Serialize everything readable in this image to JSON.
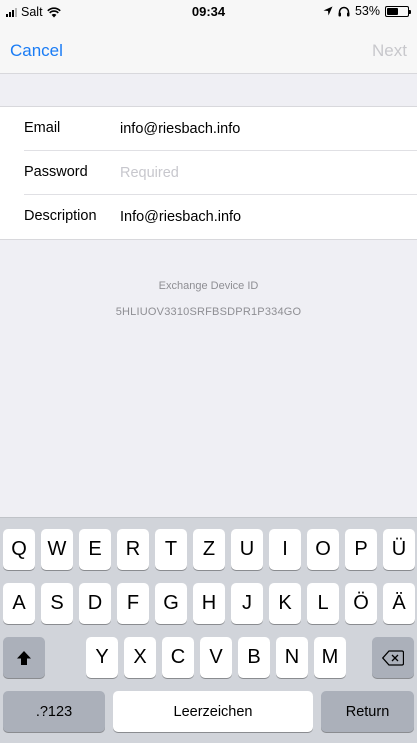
{
  "status_bar": {
    "carrier": "Salt",
    "time": "09:34",
    "battery": "53%",
    "battery_level": 0.53,
    "icons": [
      "signal-icon",
      "wifi-icon",
      "location-icon",
      "headphones-icon",
      "battery-icon"
    ]
  },
  "nav": {
    "cancel_label": "Cancel",
    "next_label": "Next"
  },
  "form": {
    "email_label": "Email",
    "email_value": "info@riesbach.info",
    "password_label": "Password",
    "password_placeholder": "Required",
    "description_label": "Description",
    "description_value": "Info@riesbach.info"
  },
  "device": {
    "title": "Exchange Device ID",
    "id": "5HLIUOV3310SRFBSDPR1P334GO"
  },
  "keyboard": {
    "row1": [
      "Q",
      "W",
      "E",
      "R",
      "T",
      "Z",
      "U",
      "I",
      "O",
      "P",
      "Ü"
    ],
    "row2": [
      "A",
      "S",
      "D",
      "F",
      "G",
      "H",
      "J",
      "K",
      "L",
      "Ö",
      "Ä"
    ],
    "row3": [
      "Y",
      "X",
      "C",
      "V",
      "B",
      "N",
      "M"
    ],
    "numbers_label": ".?123",
    "space_label": "Leerzeichen",
    "return_label": "Return",
    "shift_icon": "shift-icon",
    "delete_icon": "delete-icon"
  }
}
